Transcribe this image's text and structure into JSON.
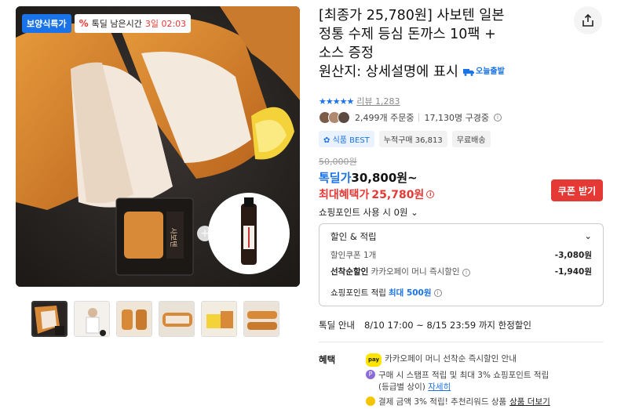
{
  "gallery": {
    "badge_brand": "보양식특가",
    "badge_timer_pct": "%",
    "badge_timer_label": "톡딜 남은시간",
    "badge_timer_value": "3일 02:03"
  },
  "product": {
    "title_line1": "[최종가 25,780원] 사보텐 일본",
    "title_line2": "정통 수제 등심 돈까스 10팩 +",
    "title_line3": "소스 증정",
    "title_line4": "원산지: 상세설명에 표시",
    "delivery_badge": "오늘출발"
  },
  "rating": {
    "stars": "★★★★★",
    "score": 5,
    "review_label": "리뷰 1,283"
  },
  "stats": {
    "orders": "2,499개 주문중",
    "watchers": "17,130명 구경중"
  },
  "tags": [
    "식품 BEST",
    "누적구매 36,813",
    "무료배송"
  ],
  "price": {
    "original": "50,000원",
    "deal_label": "톡딜가",
    "deal_price": "30,800원~",
    "max_label": "최대혜택가",
    "max_price": "25,780원",
    "coupon_button": "쿠폰 받기",
    "points_usage": "쇼핑포인트 사용 시 0원"
  },
  "discount": {
    "header": "할인 & 적립",
    "rows": [
      {
        "label": "할인쿠폰 1개",
        "value": "-3,080원"
      },
      {
        "label_bold": "선착순할인",
        "label": "카카오페이 머니 즉시할인",
        "value": "-1,940원"
      }
    ],
    "points_label": "쇼핑포인트 적립",
    "points_value": "최대 500원"
  },
  "special": {
    "label": "톡딜 안내",
    "text": "8/10 17:00 ~ 8/15 23:59 까지 한정할인"
  },
  "benefits": {
    "label": "혜택",
    "line1": "카카오페이 머니 선착순 즉시할인 안내",
    "line2a": "구매 시 스탬프 적립 및 최대 3% 쇼핑포인트 적립",
    "line2b": "(등급별 상이)",
    "line2_link": "자세히",
    "line3a": "결제 금액 3% 적립! 추천리워드 상품",
    "line3_link": "상품 더보기"
  },
  "colors": {
    "accent": "#1a73e8",
    "sale": "#e53935"
  }
}
